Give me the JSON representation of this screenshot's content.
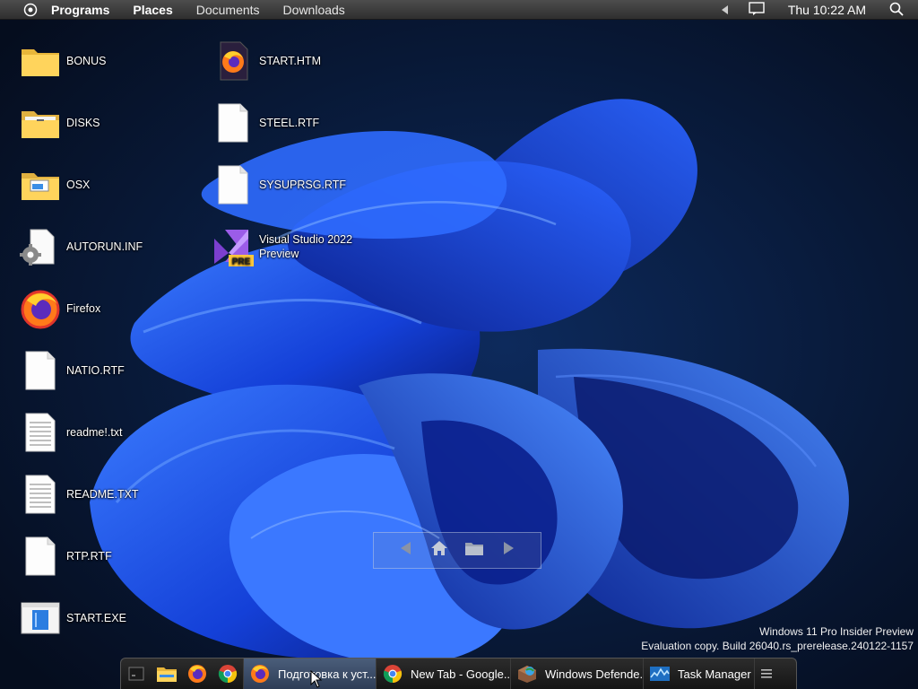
{
  "topbar": {
    "menus": [
      "Programs",
      "Places",
      "Documents",
      "Downloads"
    ],
    "clock": "Thu 10:22 AM"
  },
  "desktop_icons": [
    {
      "label": "BONUS",
      "icon": "folder-icon"
    },
    {
      "label": "DISKS",
      "icon": "folder-disks-icon"
    },
    {
      "label": "OSX",
      "icon": "folder-osx-icon"
    },
    {
      "label": "AUTORUN.INF",
      "icon": "settings-file-icon"
    },
    {
      "label": "Firefox",
      "icon": "firefox-icon"
    },
    {
      "label": "NATIO.RTF",
      "icon": "document-icon"
    },
    {
      "label": "readme!.txt",
      "icon": "text-file-icon"
    },
    {
      "label": "README.TXT",
      "icon": "text-file-icon"
    },
    {
      "label": "RTP.RTF",
      "icon": "document-icon"
    },
    {
      "label": "START.EXE",
      "icon": "exe-window-icon"
    },
    {
      "label": "START.HTM",
      "icon": "firefox-html-icon"
    },
    {
      "label": "STEEL.RTF",
      "icon": "document-icon"
    },
    {
      "label": "SYSUPRSG.RTF",
      "icon": "document-icon"
    },
    {
      "label": "Visual Studio 2022 Preview",
      "icon": "visual-studio-preview-icon",
      "badge": "PRE"
    }
  ],
  "watermark": {
    "line1": "Windows 11 Pro Insider Preview",
    "line2": "Evaluation copy. Build 26040.rs_prerelease.240122-1157"
  },
  "taskbar": {
    "launchers": [
      "terminal-icon",
      "file-explorer-icon",
      "firefox-icon",
      "chrome-icon"
    ],
    "tasks": [
      {
        "label": "Подготовка к уст...",
        "icon": "firefox-icon",
        "active": true
      },
      {
        "label": "New Tab - Google...",
        "icon": "chrome-icon",
        "active": false
      },
      {
        "label": "Windows Defende...",
        "icon": "windows-defender-icon",
        "active": false
      },
      {
        "label": "Task Manager",
        "icon": "task-manager-icon",
        "active": false
      }
    ]
  },
  "colors": {
    "wallpaper_bg": "#071326",
    "bloom_blue": "#1a4fe0",
    "topbar": "#3a3a3a",
    "taskbar_active": "#3f5170"
  }
}
